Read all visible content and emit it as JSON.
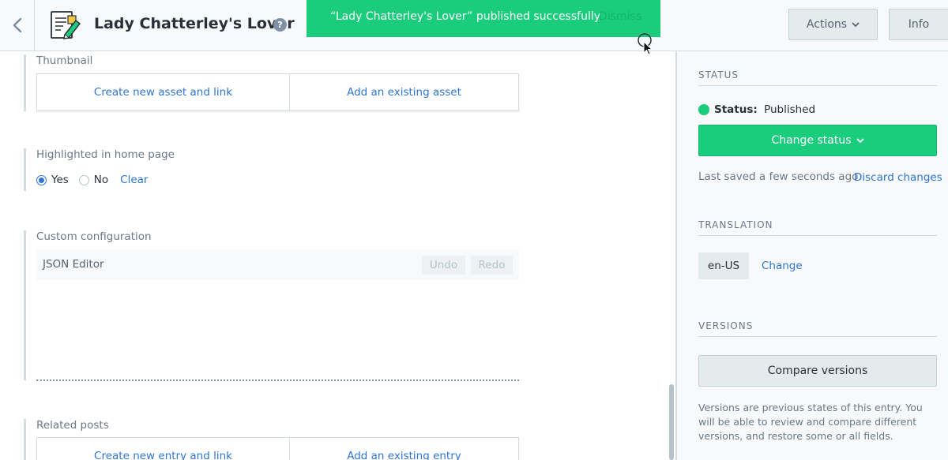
{
  "header": {
    "title": "Lady Chatterley's Lover",
    "help_glyph": "?",
    "actions_label": "Actions",
    "info_label": "Info"
  },
  "toast": {
    "message": "“Lady Chatterley's Lover” published successfully",
    "dismiss": "Dismiss"
  },
  "fields": {
    "thumbnail": {
      "label": "Thumbnail",
      "create_link": "Create new asset and link",
      "existing_link": "Add an existing asset"
    },
    "highlighted": {
      "label": "Highlighted in home page",
      "yes": "Yes",
      "no": "No",
      "clear": "Clear",
      "selected": "Yes"
    },
    "custom_config": {
      "label": "Custom configuration",
      "editor_title": "JSON Editor",
      "undo": "Undo",
      "redo": "Redo"
    },
    "related_posts": {
      "label": "Related posts",
      "create_link": "Create new entry and link",
      "existing_link": "Add an existing entry"
    }
  },
  "sidebar": {
    "status": {
      "heading": "STATUS",
      "label": "Status:",
      "value": "Published",
      "change_button": "Change status",
      "saved_text": "Last saved a few seconds ago",
      "discard": "Discard changes",
      "color": "#19cd7d"
    },
    "translation": {
      "heading": "TRANSLATION",
      "locale": "en-US",
      "change": "Change"
    },
    "versions": {
      "heading": "VERSIONS",
      "compare_button": "Compare versions",
      "note": "Versions are previous states of this entry. You will be able to review and compare different versions, and restore some or all fields."
    }
  },
  "icons": [
    "chevron-left-icon",
    "entry-content-icon",
    "help-icon",
    "chevron-down-icon",
    "mouse-cursor-icon"
  ]
}
